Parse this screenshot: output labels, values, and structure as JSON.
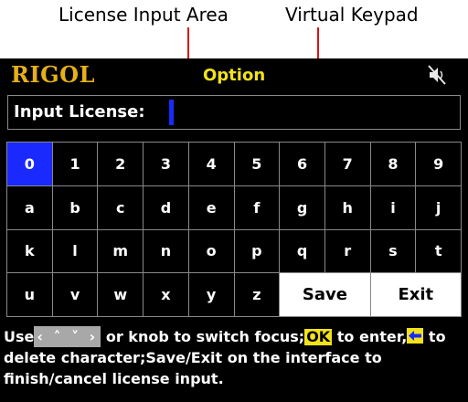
{
  "callouts": {
    "license_input_area": "License Input Area",
    "virtual_keypad": "Virtual Keypad",
    "arrow_color": "#e01010"
  },
  "header": {
    "brand": "RIGOL",
    "title": "Option",
    "sound_icon": "speaker-muted-icon"
  },
  "license": {
    "label": "Input License:",
    "value": ""
  },
  "keypad": {
    "rows": [
      [
        "0",
        "1",
        "2",
        "3",
        "4",
        "5",
        "6",
        "7",
        "8",
        "9"
      ],
      [
        "a",
        "b",
        "c",
        "d",
        "e",
        "f",
        "g",
        "h",
        "i",
        "j"
      ],
      [
        "k",
        "l",
        "m",
        "n",
        "o",
        "p",
        "q",
        "r",
        "s",
        "t"
      ],
      [
        "u",
        "v",
        "w",
        "x",
        "y",
        "z"
      ]
    ],
    "selected_key": "0",
    "save_label": "Save",
    "exit_label": "Exit"
  },
  "help": {
    "use": "Use",
    "arrows": "‹ ˄ ˅ ›",
    "focus_text": " or knob to switch focus;",
    "ok_key": "OK",
    "enter_text": " to enter,",
    "delete_text": " to delete character;Save/Exit on the interface to finish/cancel license input."
  },
  "colors": {
    "screen_background": "#000000",
    "brand": "#e5b01a",
    "title": "#f2e21a",
    "selection": "#1a2aff"
  }
}
